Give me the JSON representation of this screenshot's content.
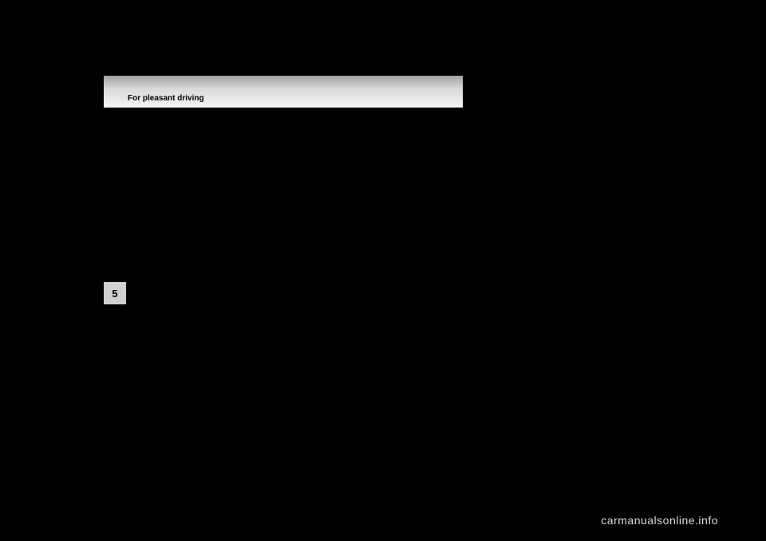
{
  "header": {
    "title": "For pleasant driving"
  },
  "tab": {
    "number": "5"
  },
  "watermark": {
    "text": "carmanualsonline.info"
  }
}
